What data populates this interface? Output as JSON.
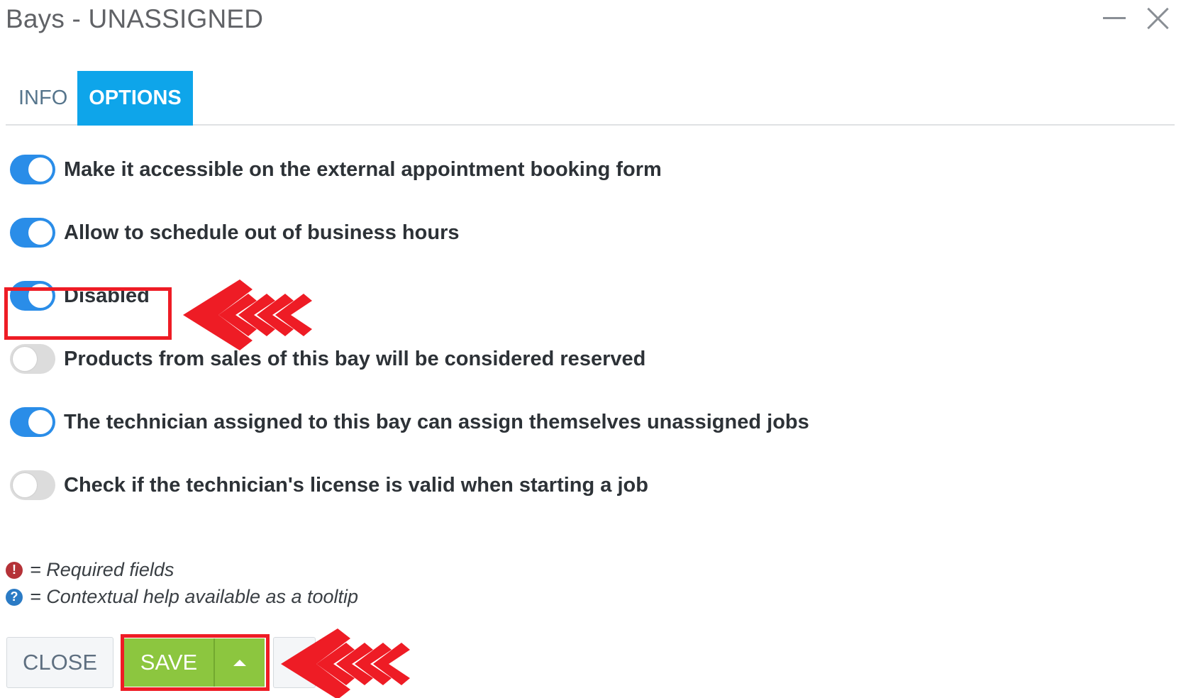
{
  "window": {
    "title": "Bays - UNASSIGNED",
    "minimize_icon": "minimize-icon",
    "close_icon": "close-icon"
  },
  "tabs": [
    {
      "label": "INFO",
      "active": false
    },
    {
      "label": "OPTIONS",
      "active": true
    }
  ],
  "options": [
    {
      "label": "Make it accessible on the external appointment booking form",
      "enabled": true
    },
    {
      "label": "Allow to schedule out of business hours",
      "enabled": true
    },
    {
      "label": "Disabled",
      "enabled": true
    },
    {
      "label": "Products from sales of this bay will be considered reserved",
      "enabled": false
    },
    {
      "label": "The technician assigned to this bay can assign themselves unassigned jobs",
      "enabled": true
    },
    {
      "label": "Check if the technician's license is valid when starting a job",
      "enabled": false
    }
  ],
  "legend": {
    "required_icon": "!",
    "required_text": "= Required fields",
    "help_icon": "?",
    "help_text": "= Contextual help available as a tooltip"
  },
  "footer": {
    "close_label": "CLOSE",
    "save_label": "SAVE"
  },
  "colors": {
    "accent_blue": "#0ea5ea",
    "toggle_on": "#2a8de8",
    "save_green": "#8cc63f",
    "annotation_red": "#ee1c25"
  }
}
